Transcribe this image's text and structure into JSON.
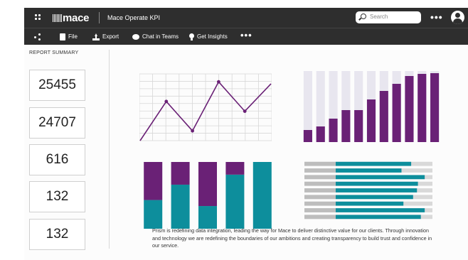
{
  "header": {
    "brand": "mace",
    "app_title": "Mace Operate KPI",
    "search_placeholder": "Search",
    "more_label": "•••"
  },
  "toolbar": {
    "items": [
      {
        "label": "File",
        "icon": "file-icon"
      },
      {
        "label": "Export",
        "icon": "export-icon"
      },
      {
        "label": "Chat in Teams",
        "icon": "chat-icon"
      },
      {
        "label": "Get Insights",
        "icon": "lightbulb-icon"
      }
    ],
    "more_label": "•••"
  },
  "report": {
    "title": "REPORT SUMMARY",
    "kpis": [
      "25455",
      "24707",
      "616",
      "132",
      "132"
    ]
  },
  "colors": {
    "purple": "#6a2176",
    "teal": "#0d8e9c",
    "light_bar": "#e8e6ef",
    "grey_bar": "#d9d9d9",
    "dark_bar": "#2e2e2e"
  },
  "caption": "Prism is redefining data integration, leading the way for Mace to deliver distinctive value for our clients. Through innovation and technology we are redefining the boundaries of our ambitions and creating transparency to build trust and confidence in our service.",
  "chart_data": [
    {
      "type": "line",
      "x": [
        1,
        2,
        3,
        4,
        5,
        6
      ],
      "y": [
        0,
        0.6,
        0.15,
        0.9,
        0.45,
        0.87
      ],
      "ylim": [
        0,
        1
      ],
      "grid": true,
      "color": "#6a2176"
    },
    {
      "type": "bar",
      "categories": [
        "1",
        "2",
        "3",
        "4",
        "5",
        "6",
        "7",
        "8",
        "9",
        "10",
        "11"
      ],
      "values": [
        0.17,
        0.22,
        0.33,
        0.45,
        0.45,
        0.6,
        0.72,
        0.82,
        0.93,
        0.96,
        0.97
      ],
      "ylim": [
        0,
        1
      ],
      "background_bar": true,
      "color": "#6a2176"
    },
    {
      "type": "bar",
      "stacked": true,
      "categories": [
        "1",
        "2",
        "3",
        "4",
        "5"
      ],
      "series": [
        {
          "color": "#0d8e9c",
          "values": [
            0.43,
            0.66,
            0.34,
            0.81,
            1.0
          ]
        },
        {
          "color": "#6a2176",
          "values": [
            0.57,
            0.34,
            0.66,
            0.19,
            0.0
          ]
        }
      ],
      "ylim": [
        0,
        1
      ]
    },
    {
      "type": "bar",
      "orientation": "horizontal",
      "categories": [
        "1",
        "2",
        "3",
        "4",
        "5",
        "6",
        "7",
        "8",
        "9"
      ],
      "values": [
        0.78,
        0.68,
        0.92,
        0.85,
        0.84,
        0.8,
        0.7,
        0.92,
        0.88
      ],
      "track_values": [
        1,
        1,
        1,
        1,
        1,
        1,
        1,
        1,
        1
      ],
      "xlim": [
        0,
        1
      ],
      "color": "#0d8e9c"
    }
  ]
}
